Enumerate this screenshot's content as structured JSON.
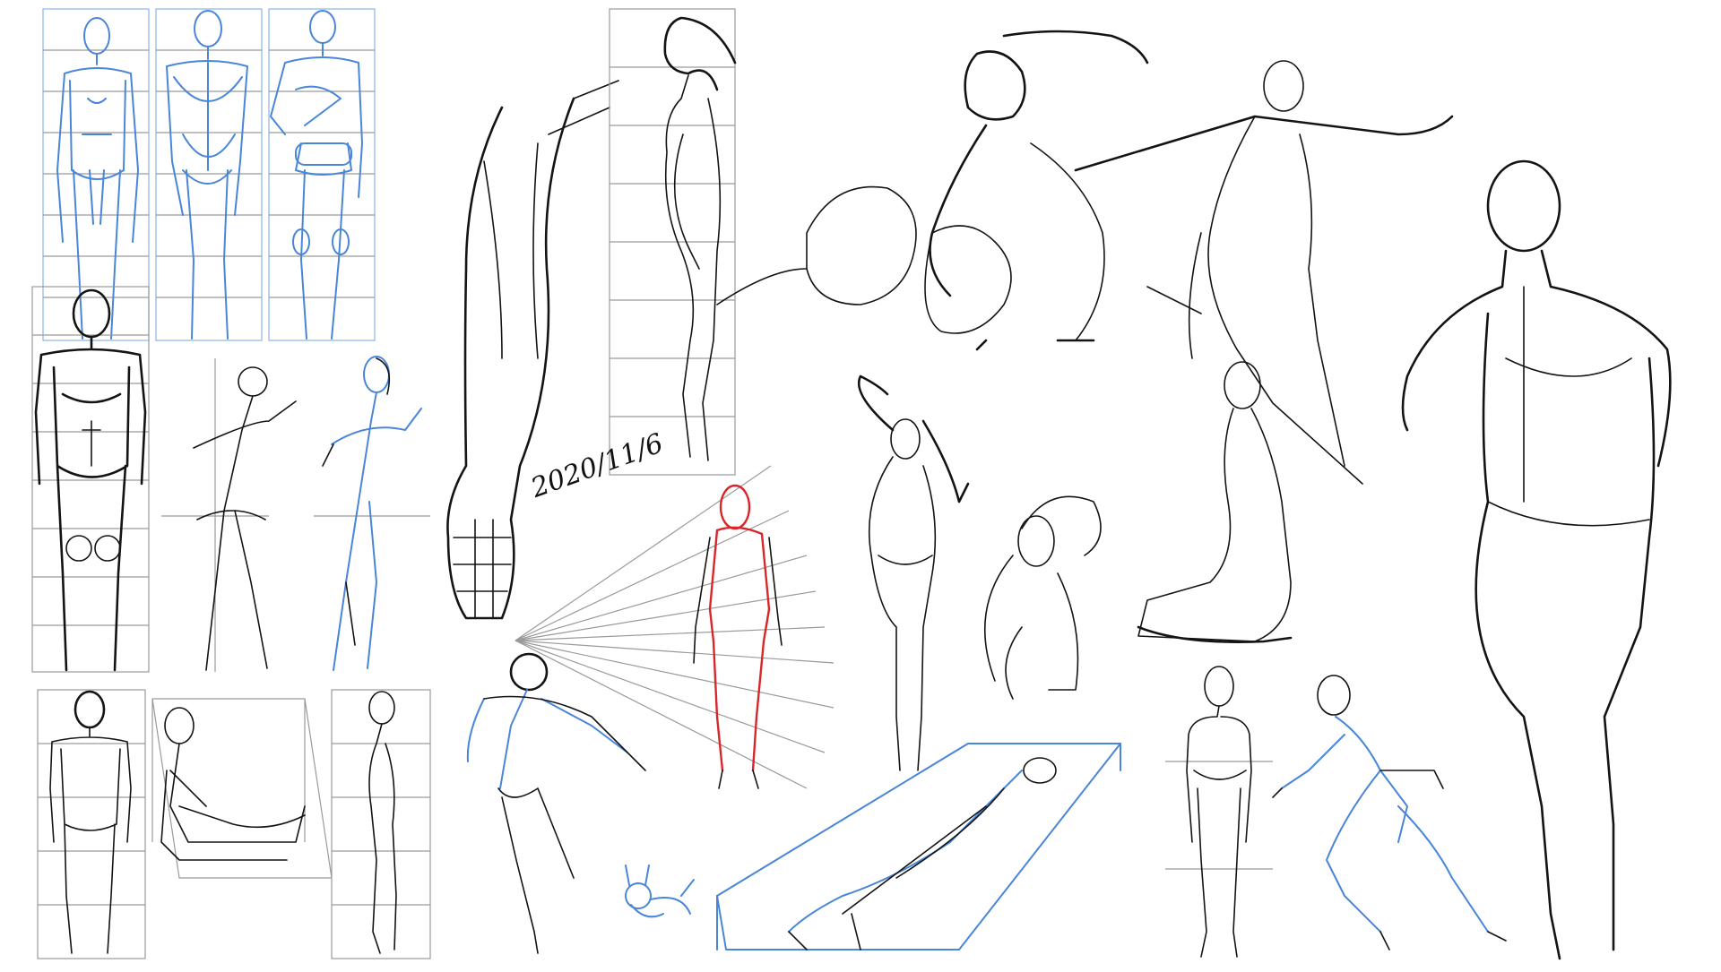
{
  "date_label": "2020/11/6",
  "colors": {
    "ink": "#141414",
    "blue_sketch": "#4a86d8",
    "red_sketch": "#d8262a",
    "grid": "#9a9a9a",
    "background": "#ffffff"
  }
}
